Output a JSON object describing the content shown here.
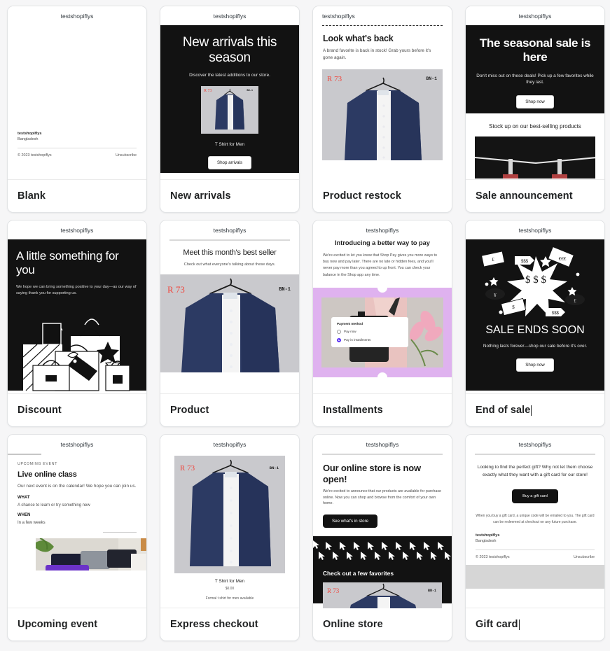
{
  "brand": {
    "name": "testshopiflys",
    "country": "Bangladesh",
    "copyright": "© 2023 testshopiflys",
    "unsubscribe": "Unsubscribe"
  },
  "product": {
    "price": "R 73",
    "sku": "BN-1",
    "title": "T Shirt for Men",
    "amount": "$0.00",
    "desc": "Formal t shirt for men available"
  },
  "cards": [
    {
      "caption": "Blank",
      "editing": false
    },
    {
      "caption": "New arrivals",
      "editing": false,
      "heading": "New arrivals this season",
      "sub": "Discover the latest additions to our store.",
      "button": "Shop arrivals"
    },
    {
      "caption": "Product restock",
      "editing": false,
      "heading": "Look what's back",
      "body": "A brand favorite is back in stock! Grab yours before it's gone again."
    },
    {
      "caption": "Sale announcement",
      "editing": false,
      "heading": "The seasonal sale is here",
      "sub": "Don't miss out on these deals! Pick up a few favorites while they last.",
      "button": "Shop now",
      "second": "Stock up on our best-selling products"
    },
    {
      "caption": "Discount",
      "editing": false,
      "heading": "A little something for you",
      "sub": "We hope we can bring something positive to your day—as our way of saying thank you for supporting us."
    },
    {
      "caption": "Product",
      "editing": false,
      "heading": "Meet this month's best seller",
      "sub": "Check out what everyone's talking about these days."
    },
    {
      "caption": "Installments",
      "editing": false,
      "heading": "Introducing a better way to pay",
      "body": "We're excited to let you know that Shop Pay gives you more ways to buy now and pay later. There are no late or hidden fees, and you'll never pay more than you agreed to up front. You can check your balance in the Shop app any time.",
      "pm_title": "Payment method",
      "pm_option1": "Pay now",
      "pm_option2": "Pay in installments"
    },
    {
      "caption": "End of sale",
      "editing": true,
      "heading": "SALE ENDS SOON",
      "sub": "Nothing lasts forever—shop our sale before it's over.",
      "button": "Shop now"
    },
    {
      "caption": "Upcoming event",
      "editing": false,
      "eyebrow": "UPCOMING EVENT",
      "heading": "Live online class",
      "body": "Our next event is on the calendar! We hope you can join us.",
      "label1": "WHAT",
      "value1": "A chance to learn or try something new",
      "label2": "WHEN",
      "value2": "In a few weeks"
    },
    {
      "caption": "Express checkout",
      "editing": false
    },
    {
      "caption": "Online store",
      "editing": false,
      "heading": "Our online store is now open!",
      "body": "We're excited to announce that our products are available for purchase online. Now you can shop and browse from the comfort of your own home.",
      "button": "See what's in store",
      "second": "Check out a few favorites"
    },
    {
      "caption": "Gift card",
      "editing": true,
      "body": "Looking to find the perfect gift? Why not let them choose exactly what they want with a gift card for our store!",
      "button": "Buy a gift card",
      "note": "When you buy a gift card, a unique code will be emailed to you. The gift card can be redeemed at checkout on any future purchase."
    }
  ],
  "colors": {
    "page_bg": "#f6f6f7",
    "dark": "#121212",
    "accent_price": "#f0473e",
    "lilac": "#dfb2ef",
    "shop_purple": "#5a31f4"
  }
}
